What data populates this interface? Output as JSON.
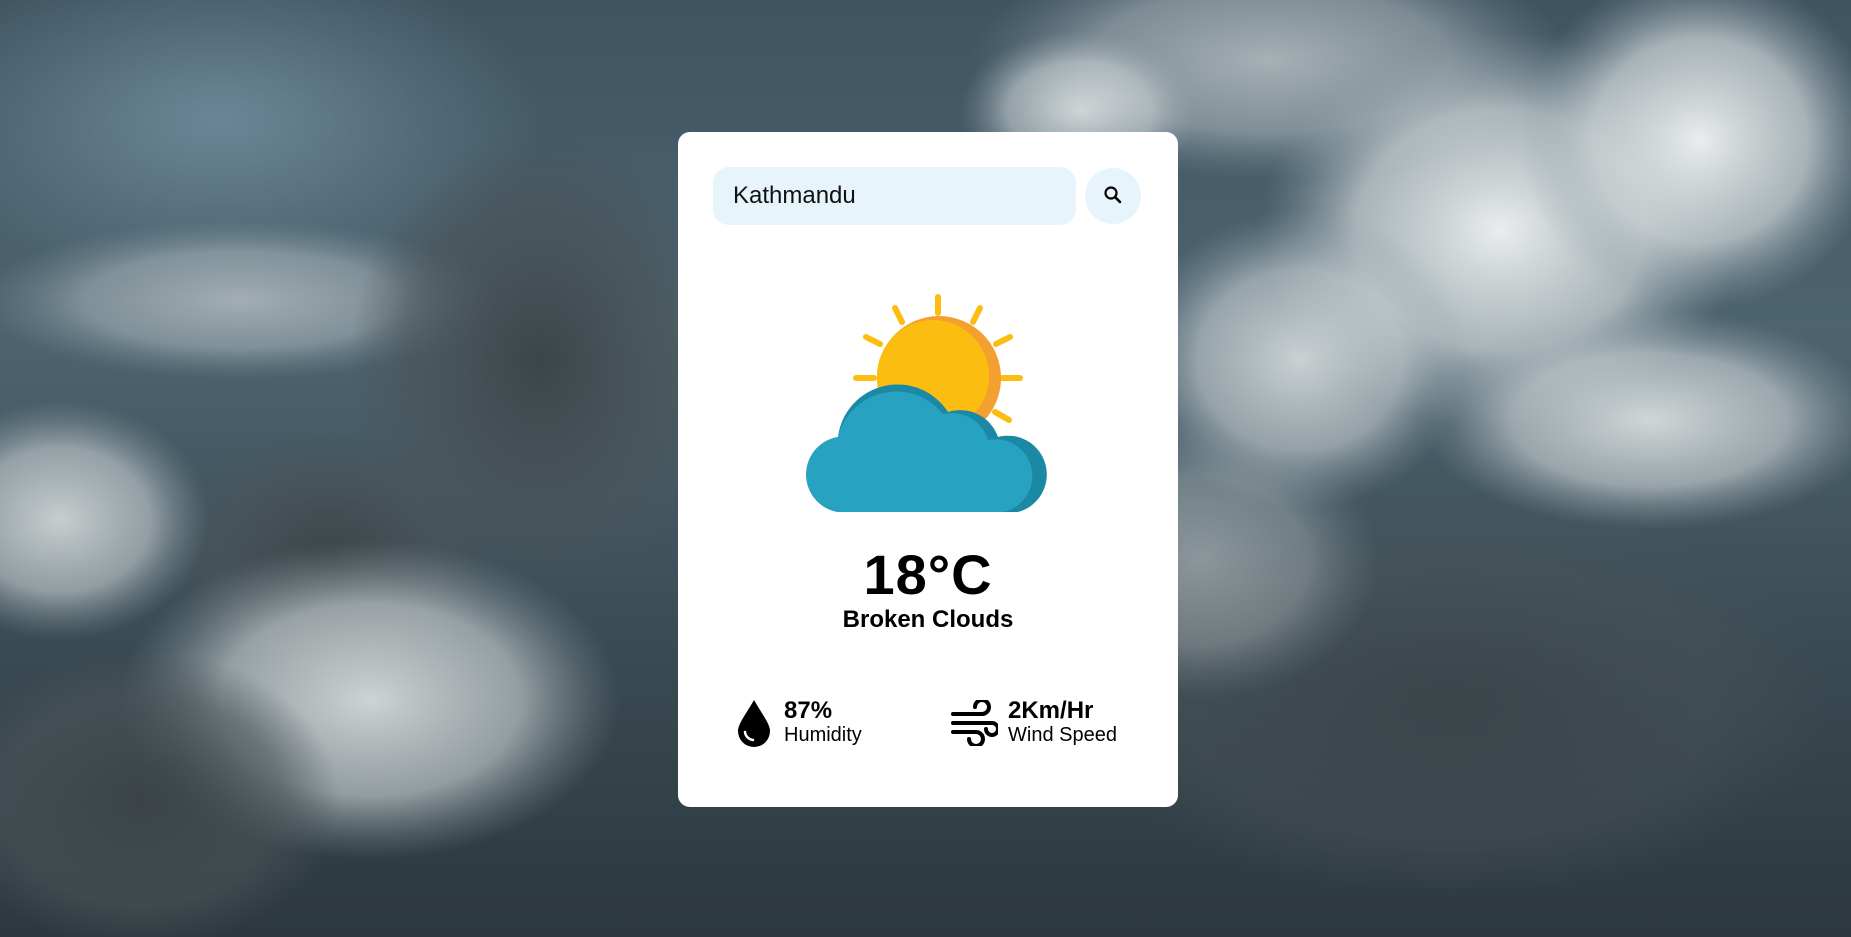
{
  "search": {
    "value": "Kathmandu",
    "button_icon": "search-icon"
  },
  "weather": {
    "icon": "sun-behind-cloud-icon",
    "temperature": "18°C",
    "description": "Broken Clouds"
  },
  "details": {
    "humidity": {
      "value": "87%",
      "label": "Humidity",
      "icon": "water-drop-icon"
    },
    "wind": {
      "value": "2Km/Hr",
      "label": "Wind Speed",
      "icon": "wind-icon"
    }
  },
  "colors": {
    "card_bg": "#ffffff",
    "input_bg": "#e8f4fb",
    "sun": "#fbbd0f",
    "sun_shade": "#f59f2e",
    "cloud": "#27a2c1",
    "cloud_shade": "#1b89a6"
  }
}
